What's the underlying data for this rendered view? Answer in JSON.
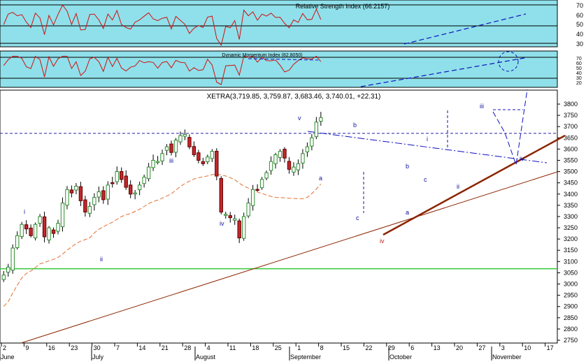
{
  "panels": {
    "rsi": {
      "title": "Relative Strength Index (66.2157)",
      "ticks": [
        "70",
        "60",
        "50",
        "40",
        "30"
      ],
      "tick_values": [
        70,
        60,
        50,
        40,
        30
      ],
      "range": [
        25,
        75
      ],
      "bands": [
        70,
        30
      ],
      "mid": 50,
      "background": "#8fe0ea"
    },
    "dmi": {
      "title": "Dynamic Momentum Index (82.8050)",
      "ticks": [
        "70",
        "60",
        "50",
        "40",
        "30",
        "20"
      ],
      "tick_values": [
        70,
        60,
        50,
        40,
        30,
        20
      ],
      "range": [
        10,
        80
      ],
      "bands": [
        70,
        30
      ],
      "background": "#8fe0ea"
    }
  },
  "chart_data": {
    "type": "candlestick",
    "title": "XETRA(3,719.85, 3,759.87, 3,683.46, 3,740.01, +22.31)",
    "ylim": [
      2725,
      3850
    ],
    "y_ticks": [
      3800,
      3750,
      3700,
      3650,
      3600,
      3550,
      3500,
      3450,
      3400,
      3350,
      3300,
      3250,
      3200,
      3150,
      3100,
      3050,
      3000,
      2950,
      2900,
      2850,
      2800,
      2750
    ],
    "x_ticks": [
      "2",
      "9",
      "16",
      "23",
      "30",
      "7",
      "14",
      "21",
      "28",
      "4",
      "11",
      "18",
      "25",
      "1",
      "8",
      "15",
      "22",
      "29",
      "6",
      "13",
      "20",
      "27",
      "3",
      "10",
      "17"
    ],
    "months": [
      "June",
      "July",
      "August",
      "September",
      "October",
      "November"
    ],
    "moving_average_color": "#e07030",
    "up_color": "#2e8b2e",
    "down_color": "#c0282c",
    "reference_lines": [
      {
        "name": "horizontal-support",
        "value": 3068,
        "color": "#34c834"
      },
      {
        "name": "prior-high",
        "value": 3670,
        "color": "#2020a0"
      }
    ],
    "wave_labels": [
      "i",
      "ii",
      "iii",
      "iv",
      "v",
      "a",
      "b",
      "c",
      "a",
      "b",
      "c",
      "iv",
      "i",
      "ii",
      "iii",
      "iv"
    ],
    "closes": [
      3040,
      3075,
      3160,
      3215,
      3265,
      3245,
      3215,
      3265,
      3300,
      3210,
      3250,
      3225,
      3270,
      3360,
      3420,
      3405,
      3435,
      3370,
      3320,
      3345,
      3385,
      3410,
      3375,
      3440,
      3450,
      3500,
      3465,
      3430,
      3400,
      3405,
      3440,
      3475,
      3520,
      3550,
      3545,
      3580,
      3610,
      3585,
      3640,
      3660,
      3665,
      3610,
      3575,
      3550,
      3535,
      3565,
      3590,
      3480,
      3320,
      3310,
      3295,
      3290,
      3205,
      3300,
      3360,
      3420,
      3420,
      3465,
      3495,
      3545,
      3575,
      3590,
      3560,
      3510,
      3520,
      3535,
      3580,
      3610,
      3650,
      3720,
      3740
    ]
  }
}
